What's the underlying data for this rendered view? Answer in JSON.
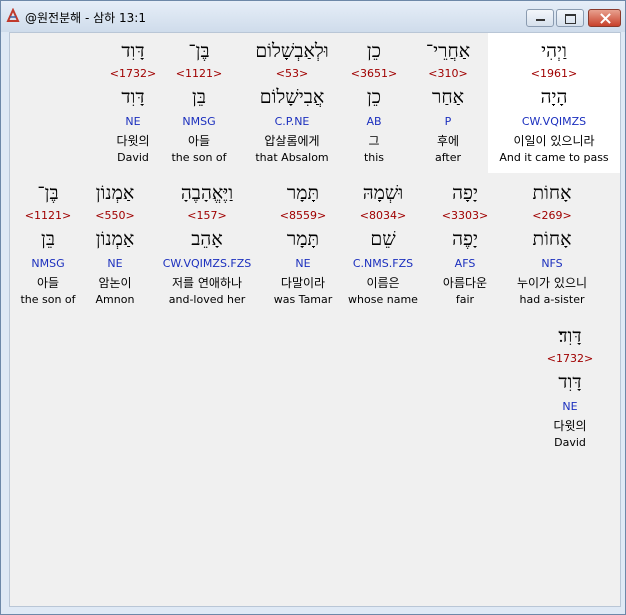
{
  "window": {
    "title": "@원전분해 - 삼하 13:1"
  },
  "words": [
    {
      "heb": "וַיְהִי",
      "strong": "<1961>",
      "lemma": "הָיָה",
      "code": "CW.VQIMZS",
      "kor": "이일이 있으니라",
      "eng": "And it came to pass"
    },
    {
      "heb": "אַחֲרֵי־",
      "strong": "<310>",
      "lemma": "אַחַר",
      "code": "P",
      "kor": "후에",
      "eng": "after"
    },
    {
      "heb": "כֵן",
      "strong": "<3651>",
      "lemma": "כֵן",
      "code": "AB",
      "kor": "그",
      "eng": "this"
    },
    {
      "heb": "וּלְאַבְשָׁלוֹם",
      "strong": "<53>",
      "lemma": "אֲבִישָׁלוֹם",
      "code": "C.P.NE",
      "kor": "압살롬에게",
      "eng": "that Absalom"
    },
    {
      "heb": "בֶּן־",
      "strong": "<1121>",
      "lemma": "בֵּן",
      "code": "NMSG",
      "kor": "아들",
      "eng": "the son of"
    },
    {
      "heb": "דָּוִד",
      "strong": "<1732>",
      "lemma": "דָּוִד",
      "code": "NE",
      "kor": "다윗의",
      "eng": "David"
    },
    {
      "heb": "אָחוֹת",
      "strong": "<269>",
      "lemma": "אָחוֹת",
      "code": "NFS",
      "kor": "누이가 있으니",
      "eng": "had a-sister"
    },
    {
      "heb": "יָפָה",
      "strong": "<3303>",
      "lemma": "יָפֶה",
      "code": "AFS",
      "kor": "아름다운",
      "eng": "fair"
    },
    {
      "heb": "וּשְׁמָהּ",
      "strong": "<8034>",
      "lemma": "שֵׁם",
      "code": "C.NMS.FZS",
      "kor": "이름은",
      "eng": "whose name"
    },
    {
      "heb": "תָּמָר",
      "strong": "<8559>",
      "lemma": "תָּמָר",
      "code": "NE",
      "kor": "다말이라",
      "eng": "was Tamar"
    },
    {
      "heb": "וַיֶּאֱהָבֶהָ",
      "strong": "<157>",
      "lemma": "אָהֵב",
      "code": "CW.VQIMZS.FZS",
      "kor": "저를 연애하나",
      "eng": "and-loved her"
    },
    {
      "heb": "אַמְנוֹן",
      "strong": "<550>",
      "lemma": "אַמְנוֹן",
      "code": "NE",
      "kor": "암논이",
      "eng": "Amnon"
    },
    {
      "heb": "בֶּן־",
      "strong": "<1121>",
      "lemma": "בֵּן",
      "code": "NMSG",
      "kor": "아들",
      "eng": "the son of"
    },
    {
      "heb": "דָּוִד׃",
      "strong": "<1732>",
      "lemma": "דָּוִד",
      "code": "NE",
      "kor": "다윗의",
      "eng": "David"
    }
  ]
}
